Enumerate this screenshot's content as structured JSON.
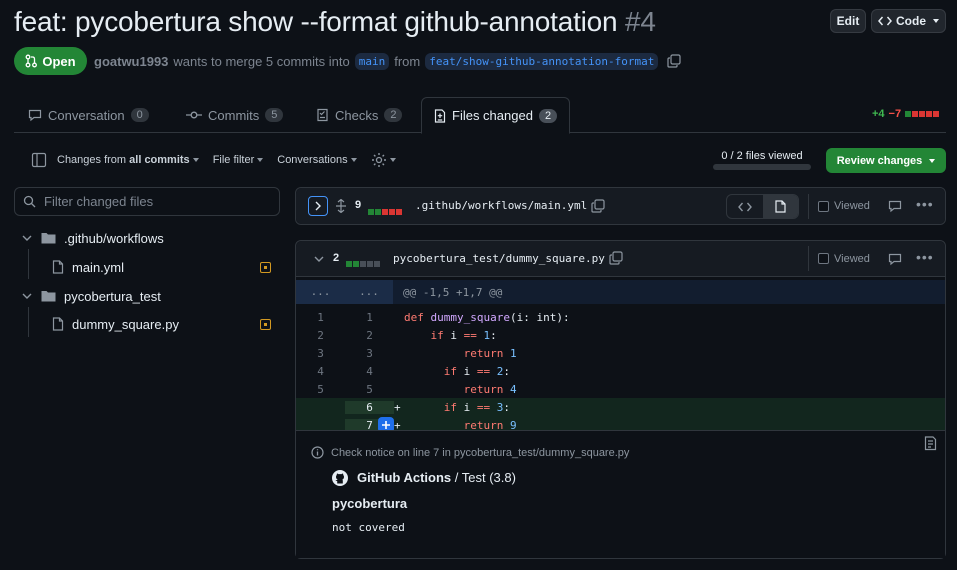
{
  "pr": {
    "title": "feat: pycobertura show --format github-annotation",
    "number": "#4",
    "state": "Open",
    "author": "goatwu1993",
    "merge_text": "wants to merge 5 commits into",
    "base_branch": "main",
    "from_text": "from",
    "head_branch": "feat/show-github-annotation-format"
  },
  "header_buttons": {
    "edit": "Edit",
    "code": "Code"
  },
  "tabs": [
    {
      "label": "Conversation",
      "count": "0"
    },
    {
      "label": "Commits",
      "count": "5"
    },
    {
      "label": "Checks",
      "count": "2"
    },
    {
      "label": "Files changed",
      "count": "2"
    }
  ],
  "diffstat": {
    "additions": "+4",
    "deletions": "−7"
  },
  "toolbar": {
    "changes_prefix": "Changes from",
    "changes_value": "all commits",
    "file_filter": "File filter",
    "conversations": "Conversations",
    "files_viewed": "0 / 2 files viewed",
    "review_changes": "Review changes"
  },
  "file_tree": {
    "filter_placeholder": "Filter changed files",
    "folder1": ".github/workflows",
    "file1": "main.yml",
    "folder2": "pycobertura_test",
    "file2": "dummy_square.py"
  },
  "file1": {
    "changes": "9",
    "path": ".github/workflows/main.yml",
    "viewed_label": "Viewed"
  },
  "file2": {
    "changes": "2",
    "path": "pycobertura_test/dummy_square.py",
    "viewed_label": "Viewed"
  },
  "diff": {
    "hunk_left": "...",
    "hunk_right": "...",
    "hunk_header": "@@ -1,5 +1,7 @@",
    "lines": [
      {
        "old": "1",
        "new": "1",
        "marker": "",
        "code": "def dummy_square(i: int):"
      },
      {
        "old": "2",
        "new": "2",
        "marker": "",
        "code": "    if i == 1:"
      },
      {
        "old": "3",
        "new": "3",
        "marker": "",
        "code": "        return 1"
      },
      {
        "old": "4",
        "new": "4",
        "marker": "",
        "code": "    if i == 2:"
      },
      {
        "old": "5",
        "new": "5",
        "marker": "",
        "code": "        return 4"
      },
      {
        "old": "",
        "new": "6",
        "marker": "+",
        "code": "    if i == 3:"
      },
      {
        "old": "",
        "new": "7",
        "marker": "+",
        "code": "        return 9"
      }
    ]
  },
  "annotation": {
    "notice": "Check notice on line 7 in pycobertura_test/dummy_square.py",
    "source": "GitHub Actions",
    "separator": " / ",
    "job": "Test (3.8)",
    "title": "pycobertura",
    "message": "not covered"
  },
  "colors": {
    "green": "#238636",
    "red": "#da3633",
    "accent": "#4493f8",
    "notice": "#d29922"
  }
}
